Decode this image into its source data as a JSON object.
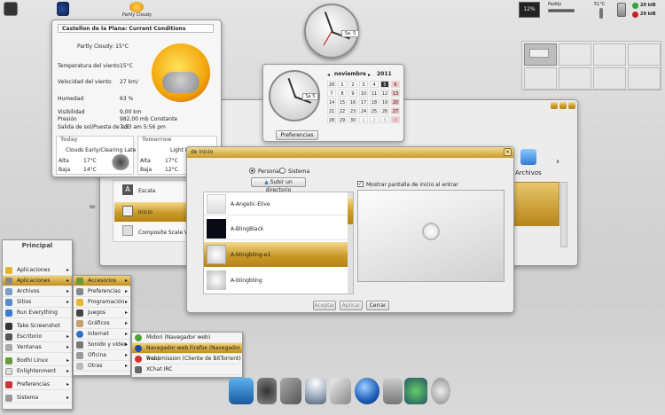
{
  "top_left": {
    "weather_tray": "Partly Cloudy"
  },
  "weather": {
    "title": "Castellon de la Plana: Current Conditions",
    "condition": "Partly Cloudy: 15°C",
    "rows": [
      {
        "k": "Temperatura del viento",
        "v": "15°C"
      },
      {
        "k": "Velocidad del viento",
        "v": "27 km/"
      },
      {
        "k": "Humedad",
        "v": "63 %"
      },
      {
        "k": "Visibilidad",
        "v": "9,00 km"
      },
      {
        "k": "Presión",
        "v": "982,00 mb  Constante"
      },
      {
        "k": "Salida de sol/Puesta de sol",
        "v": "7:33 am        5:56 pm"
      }
    ],
    "today": {
      "label": "Today",
      "desc": "Clouds Early/Clearing Late",
      "alta": "Alta",
      "alta_v": "17°C",
      "baja": "Baja",
      "baja_v": "14°C"
    },
    "tomorrow": {
      "label": "Tomorrow",
      "desc": "Light Rain",
      "alta": "Alta",
      "alta_v": "17°C",
      "baja": "Baja",
      "baja_v": "12°C"
    }
  },
  "clock": {
    "date": "Sa. 5"
  },
  "calendar": {
    "month": "noviembre",
    "year": "2011",
    "clock_date": "Sa 5",
    "pref_button": "Preferencias",
    "days": [
      "28",
      "1",
      "2",
      "3",
      "4",
      "5",
      "6",
      "7",
      "8",
      "9",
      "10",
      "11",
      "12",
      "13",
      "14",
      "15",
      "16",
      "17",
      "18",
      "19",
      "20",
      "21",
      "22",
      "23",
      "24",
      "25",
      "26",
      "27",
      "28",
      "29",
      "30",
      "1",
      "2",
      "3",
      "4"
    ]
  },
  "system_tray": {
    "cpu": "12%",
    "temp": "51°C",
    "net_up": "20 kiB",
    "net_down": "29 kiB",
    "disk": "Paddy"
  },
  "settings_window": {
    "archivos_label": "Archivos",
    "items": [
      "Escala",
      "Inicio",
      "Composite Scale Windows"
    ]
  },
  "startup_dialog": {
    "title": "de inicio",
    "radio_personal": "Personal",
    "radio_system": "Sistema",
    "upload_button": "Subir un directorio",
    "show_label": "Mostrar pantalla de inicio al entrar",
    "themes": [
      "A-Angelic-Elive",
      "A-BlingBlack",
      "A-blingbling-e1",
      "A-blingbling"
    ],
    "accept": "Aceptar",
    "apply": "Aplicar",
    "close": "Cerrar"
  },
  "main_menu": {
    "title": "Principal",
    "items": [
      "Aplicaciones favoritas",
      "Aplicaciones",
      "Archivos",
      "Sitios",
      "Run Everything",
      "Take Screenshot",
      "Escritorio",
      "Ventanas",
      "Bodhi Linux",
      "Enlightenment",
      "Preferencias",
      "Sistema"
    ]
  },
  "apps_menu": {
    "items": [
      "Accesorios",
      "Preferencias",
      "Programación",
      "Juegos",
      "Gráficos",
      "Internet",
      "Sonido y vídeo",
      "Oficina",
      "Otras"
    ]
  },
  "internet_menu": {
    "items": [
      "Midori (Navegador web)",
      "Navegador web Firefox (Navegador web)",
      "Transmission (Cliente de BitTorrent)",
      "XChat IRC"
    ]
  },
  "colors": {
    "accent": "#c9992a",
    "menu_bg": "#f4f4f4"
  }
}
